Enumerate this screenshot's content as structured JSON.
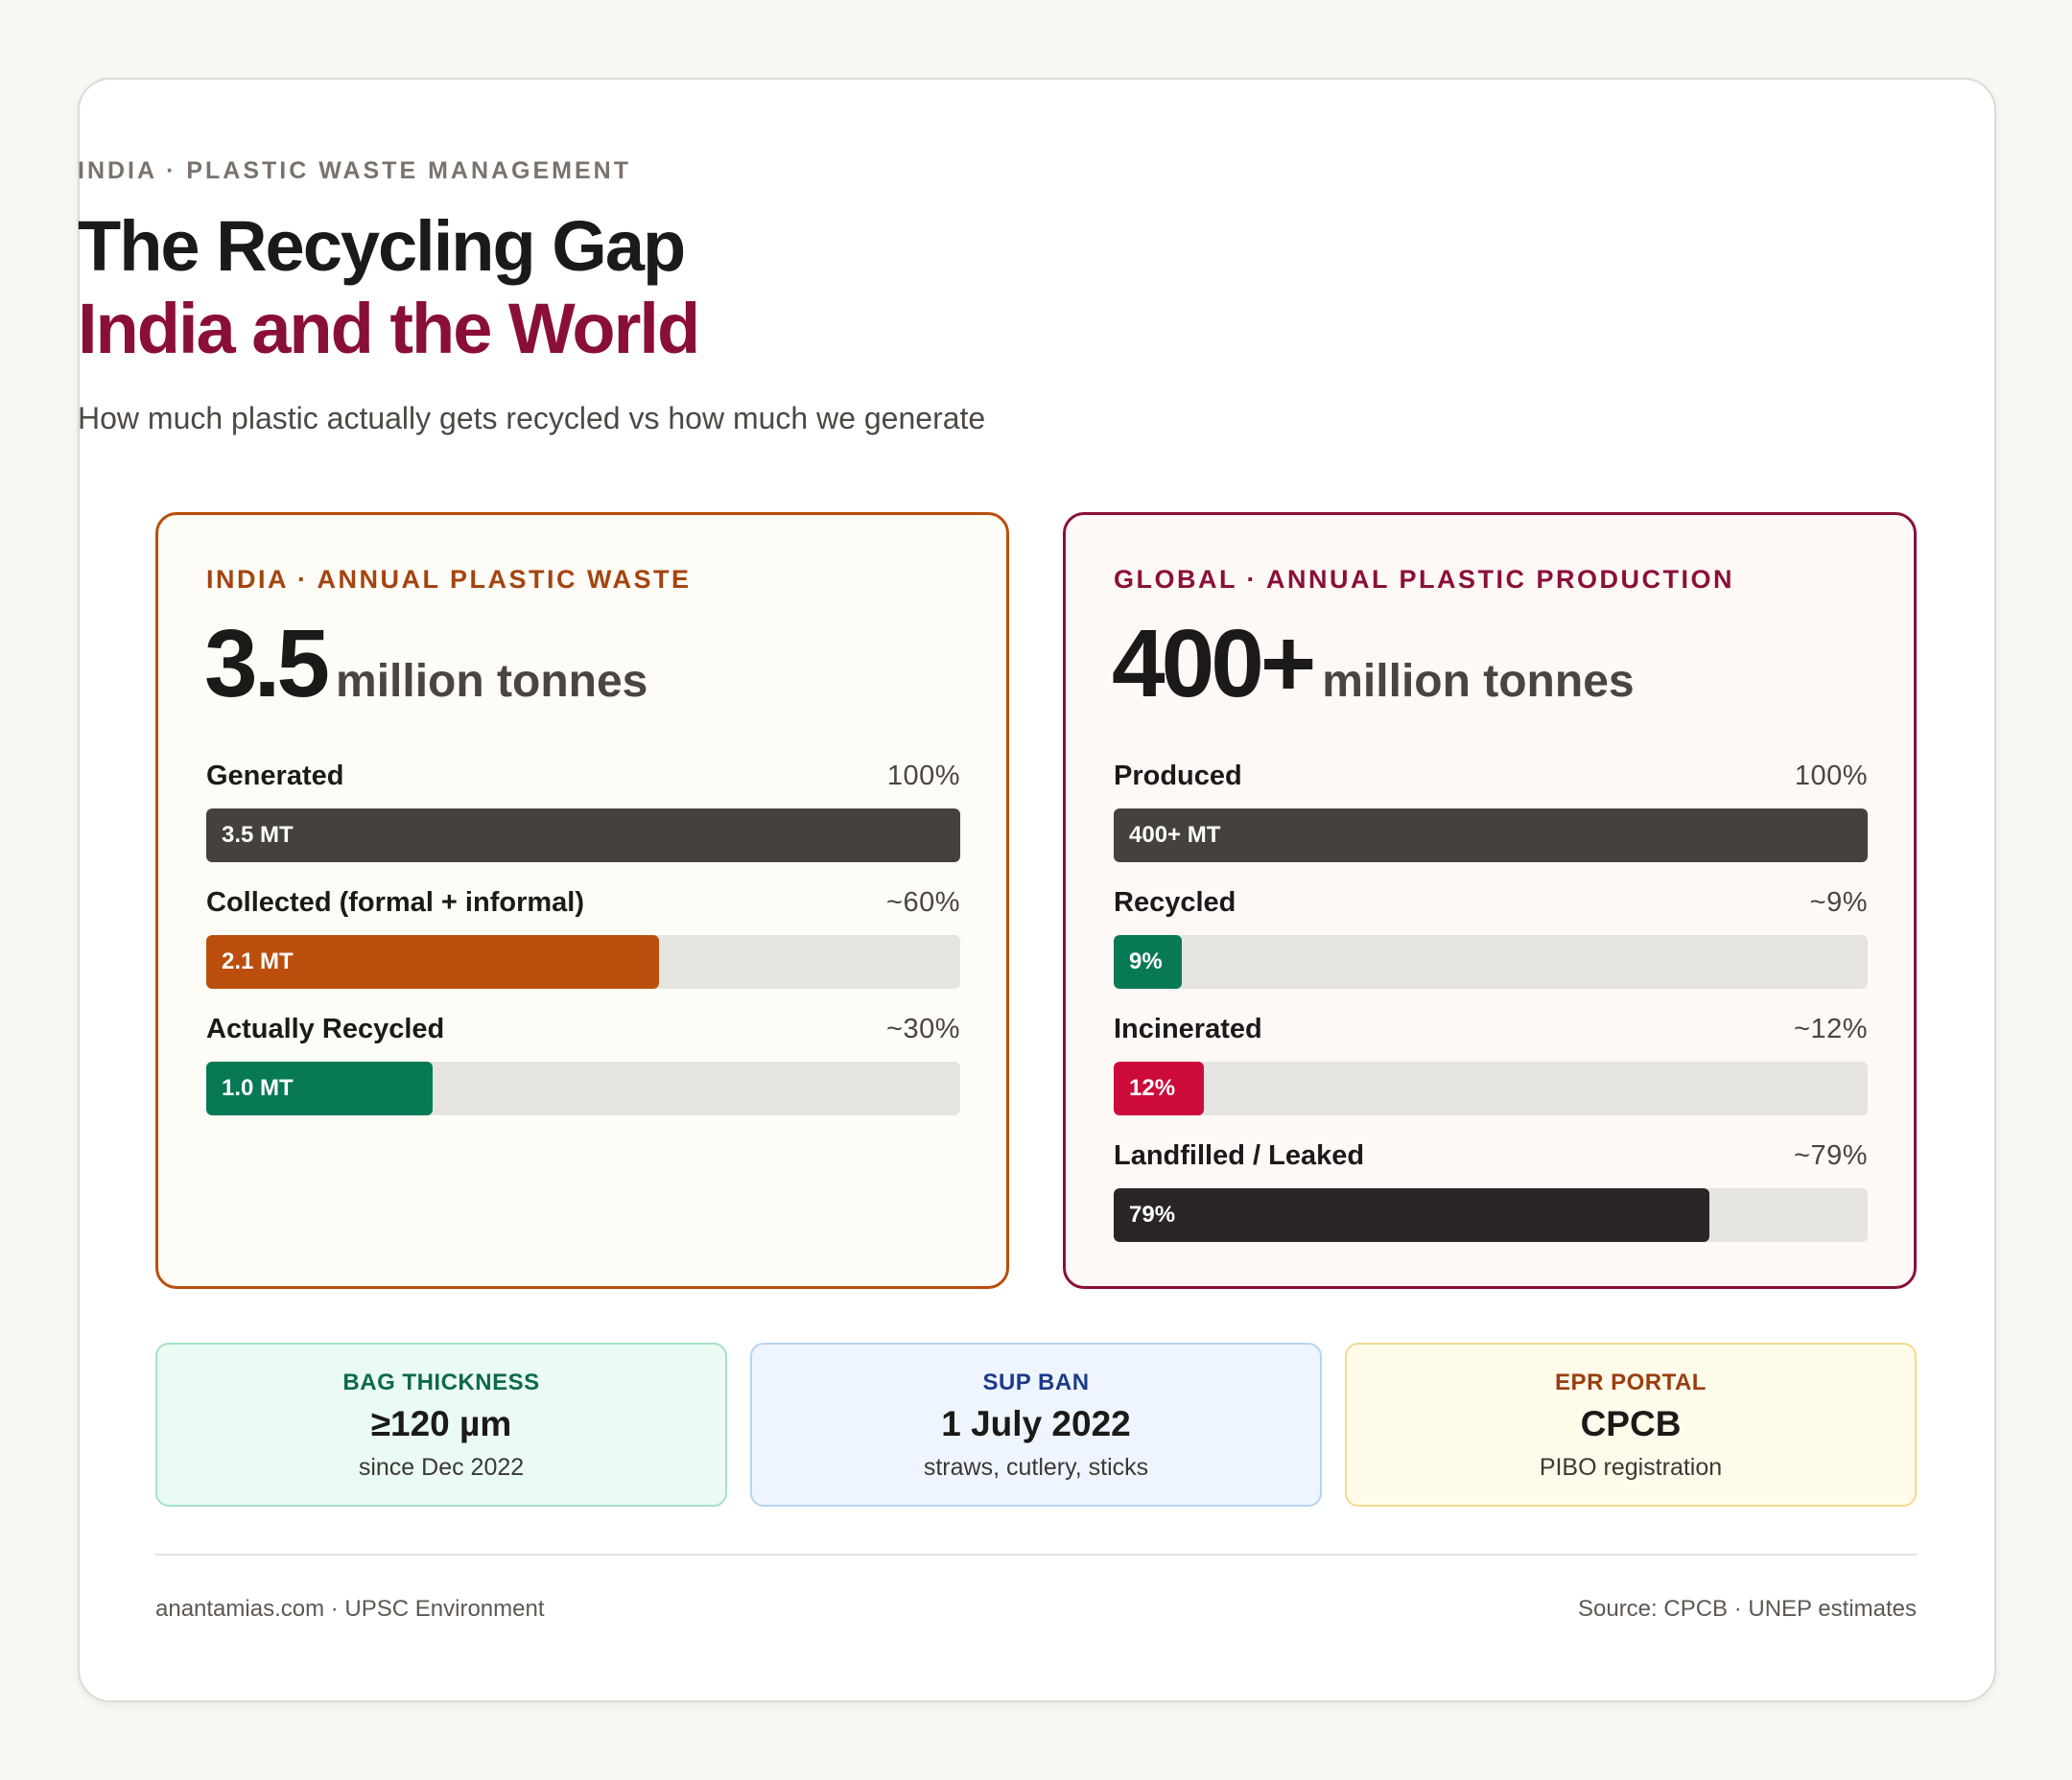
{
  "header": {
    "eyebrow": "INDIA · PLASTIC WASTE MANAGEMENT",
    "title_line1": "The Recycling Gap",
    "title_line2": "India and the World",
    "subtitle": "How much plastic actually gets recycled vs how much we generate"
  },
  "colors": {
    "accent_india": "#bb4e0c",
    "accent_global": "#8a1038",
    "dark_bar": "#45413d",
    "collected": "#bb4e0c",
    "recycled": "#077a55",
    "incinerated": "#cc0b3a",
    "landfilled": "#292524"
  },
  "india": {
    "label": "INDIA · ANNUAL PLASTIC WASTE",
    "big_number": "3.5",
    "unit": "million tonnes",
    "bars": [
      {
        "name": "Generated",
        "pct_label": "100%",
        "bar_label": "3.5 MT",
        "fraction": 1.0,
        "color": "#45413d"
      },
      {
        "name": "Collected (formal + informal)",
        "pct_label": "~60%",
        "bar_label": "2.1 MT",
        "fraction": 0.6,
        "color": "#bb4e0c"
      },
      {
        "name": "Actually Recycled",
        "pct_label": "~30%",
        "bar_label": "1.0 MT",
        "fraction": 0.3,
        "color": "#077a55"
      }
    ]
  },
  "global": {
    "label": "GLOBAL · ANNUAL PLASTIC PRODUCTION",
    "big_number": "400+",
    "unit": "million tonnes",
    "bars": [
      {
        "name": "Produced",
        "pct_label": "100%",
        "bar_label": "400+ MT",
        "fraction": 1.0,
        "color": "#45413d"
      },
      {
        "name": "Recycled",
        "pct_label": "~9%",
        "bar_label": "9%",
        "fraction": 0.09,
        "color": "#077a55"
      },
      {
        "name": "Incinerated",
        "pct_label": "~12%",
        "bar_label": "12%",
        "fraction": 0.12,
        "color": "#cc0b3a"
      },
      {
        "name": "Landfilled / Leaked",
        "pct_label": "~79%",
        "bar_label": "79%",
        "fraction": 0.79,
        "color": "#292524"
      }
    ]
  },
  "info_cards": [
    {
      "label": "BAG THICKNESS",
      "value": "≥120 µm",
      "note": "since Dec 2022"
    },
    {
      "label": "SUP BAN",
      "value": "1 July 2022",
      "note": "straws, cutlery, sticks"
    },
    {
      "label": "EPR PORTAL",
      "value": "CPCB",
      "note": "PIBO registration"
    }
  ],
  "footer": {
    "left": "anantamias.com · UPSC Environment",
    "right": "Source: CPCB · UNEP estimates"
  }
}
